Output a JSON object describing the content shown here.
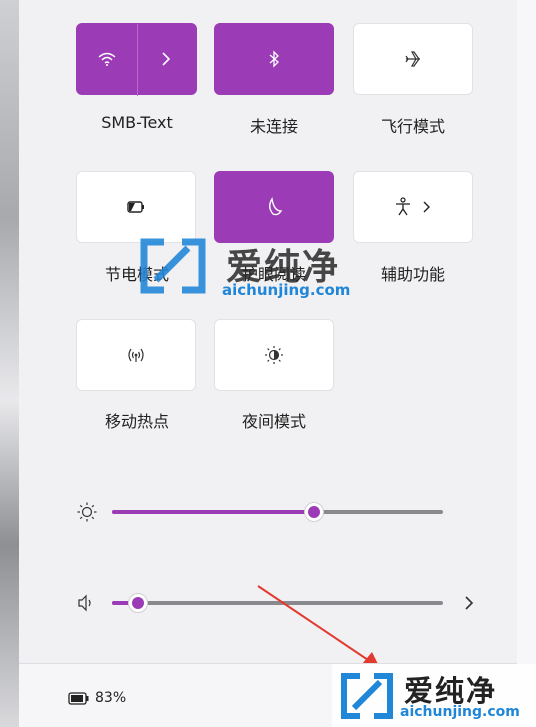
{
  "tiles": {
    "wifi": {
      "label": "SMB-Text",
      "state": "on"
    },
    "bluetooth": {
      "label": "未连接",
      "state": "on"
    },
    "airplane": {
      "label": "飞行模式",
      "state": "off"
    },
    "battery_saver": {
      "label": "节电模式",
      "state": "off"
    },
    "eye_comfort": {
      "label": "护眼阅读",
      "state": "on"
    },
    "accessibility": {
      "label": "辅助功能",
      "state": "off"
    },
    "hotspot": {
      "label": "移动热点",
      "state": "off"
    },
    "night_mode": {
      "label": "夜间模式",
      "state": "off"
    }
  },
  "brightness": {
    "level_percent": 61
  },
  "volume": {
    "level_percent": 8
  },
  "battery": {
    "percent_text": "83%"
  },
  "watermark": {
    "brand": "爱纯净",
    "url": "aichunjing.com"
  },
  "colors": {
    "accent": "#9b3bb5",
    "arrow": "#e23a2e",
    "watermark_blue": "#1f86d8"
  }
}
